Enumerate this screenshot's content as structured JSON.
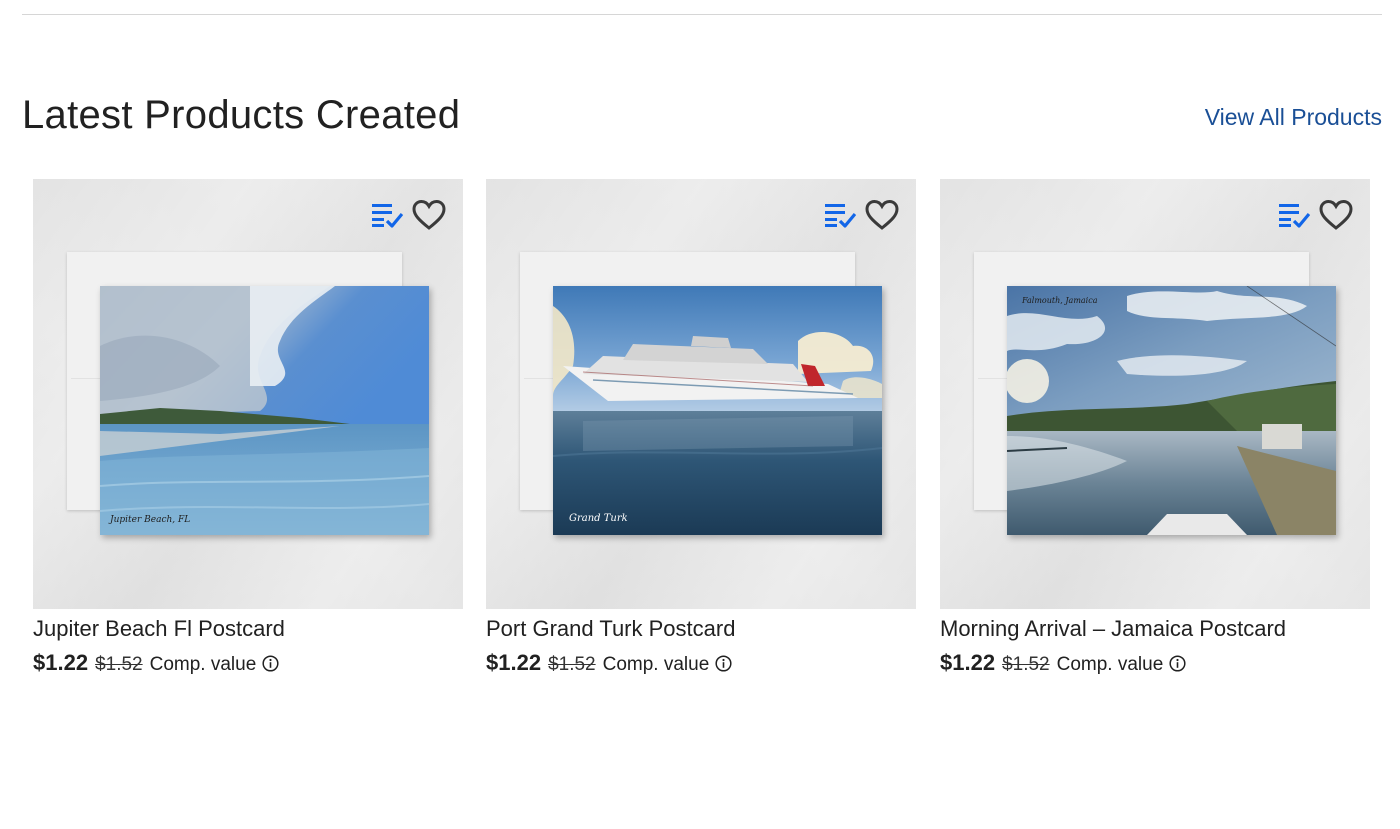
{
  "section": {
    "title": "Latest Products Created",
    "view_all_label": "View All Products"
  },
  "colors": {
    "accent_link": "#1a4f96",
    "list_icon": "#1266e8",
    "text": "#212121"
  },
  "products": [
    {
      "name": "Jupiter Beach Fl Postcard",
      "price": "$1.22",
      "old_price": "$1.52",
      "comp_label": "Comp. value",
      "photo_caption": "Jupiter Beach, FL",
      "icons": [
        "add-to-list-icon",
        "heart-icon",
        "info-icon"
      ]
    },
    {
      "name": "Port Grand Turk Postcard",
      "price": "$1.22",
      "old_price": "$1.52",
      "comp_label": "Comp. value",
      "photo_caption": "Grand Turk",
      "icons": [
        "add-to-list-icon",
        "heart-icon",
        "info-icon"
      ]
    },
    {
      "name": "Morning Arrival – Jamaica Postcard",
      "price": "$1.22",
      "old_price": "$1.52",
      "comp_label": "Comp. value",
      "photo_caption": "Falmouth, Jamaica",
      "icons": [
        "add-to-list-icon",
        "heart-icon",
        "info-icon"
      ]
    }
  ]
}
